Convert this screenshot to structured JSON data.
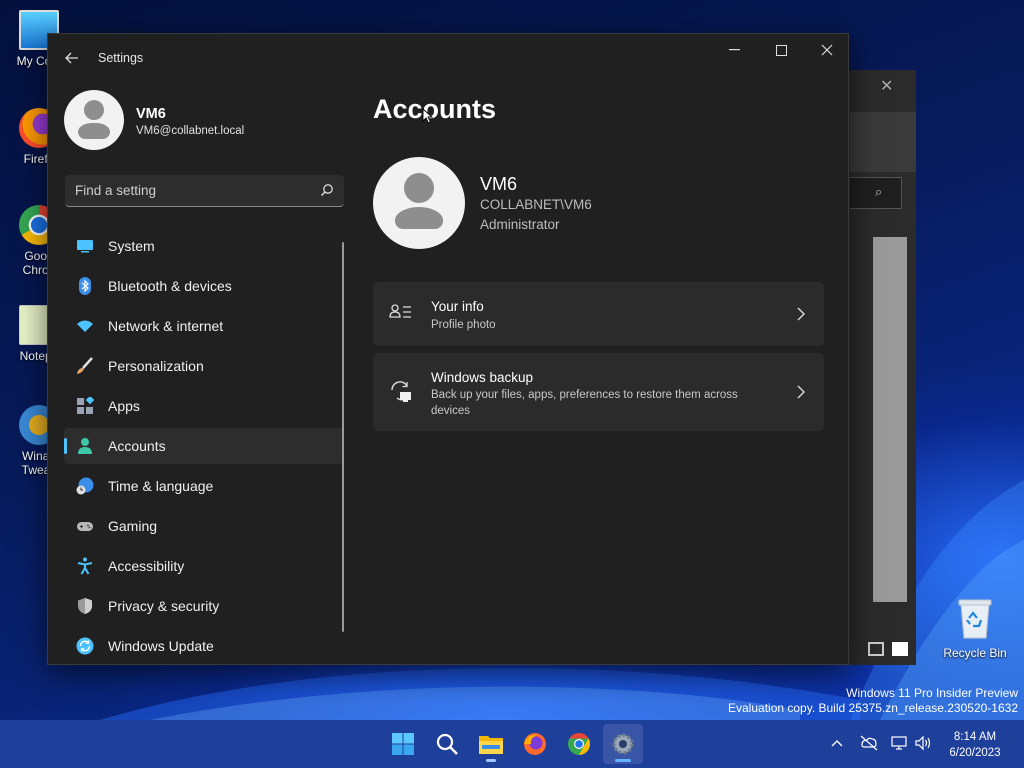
{
  "desktop": {
    "icons": [
      {
        "label": "My Com",
        "icon": "computer-icon"
      },
      {
        "label": "Firefo",
        "icon": "firefox-icon"
      },
      {
        "label": "Goog",
        "label2": "Chron",
        "icon": "chrome-icon"
      },
      {
        "label": "Notepa",
        "icon": "notepad-icon"
      },
      {
        "label": "Winae",
        "label2": "Tweak",
        "icon": "winaero-icon"
      }
    ],
    "recycle_bin": {
      "label": "Recycle Bin",
      "icon": "recycle-bin-icon"
    },
    "watermark": {
      "line1": "Windows 11 Pro Insider Preview",
      "line2": "Evaluation copy. Build 25375.zn_release.230520-1632"
    }
  },
  "window": {
    "title": "Settings",
    "back_icon": "back-arrow-icon",
    "controls": [
      "minimize-icon",
      "maximize-icon",
      "close-icon"
    ]
  },
  "profile": {
    "name": "VM6",
    "email": "VM6@collabnet.local"
  },
  "search": {
    "placeholder": "Find a setting",
    "icon": "search-icon"
  },
  "nav": {
    "items": [
      {
        "label": "System",
        "icon": "system-icon",
        "color": "#4cc2ff"
      },
      {
        "label": "Bluetooth & devices",
        "icon": "bluetooth-icon",
        "color": "#3b8eea"
      },
      {
        "label": "Network & internet",
        "icon": "wifi-icon",
        "color": "#4cc2ff"
      },
      {
        "label": "Personalization",
        "icon": "brush-icon",
        "color": "#e8a46a"
      },
      {
        "label": "Apps",
        "icon": "apps-icon",
        "color": "#9aa3b5"
      },
      {
        "label": "Accounts",
        "icon": "accounts-icon",
        "color": "#3ec6a8",
        "active": true
      },
      {
        "label": "Time & language",
        "icon": "clock-globe-icon",
        "color": "#3b8eea"
      },
      {
        "label": "Gaming",
        "icon": "gamepad-icon",
        "color": "#b8b8b8"
      },
      {
        "label": "Accessibility",
        "icon": "accessibility-icon",
        "color": "#4cc2ff"
      },
      {
        "label": "Privacy & security",
        "icon": "shield-icon",
        "color": "#9a9a9a"
      },
      {
        "label": "Windows Update",
        "icon": "update-icon",
        "color": "#4cc2ff"
      }
    ]
  },
  "main": {
    "title": "Accounts",
    "account": {
      "name": "VM6",
      "domain": "COLLABNET\\VM6",
      "role": "Administrator"
    },
    "cards": [
      {
        "title": "Your info",
        "subtitle": "Profile photo",
        "icon": "your-info-icon"
      },
      {
        "title": "Windows backup",
        "subtitle": "Back up your files, apps, preferences to restore them across devices",
        "icon": "backup-icon"
      }
    ]
  },
  "taskbar": {
    "apps": [
      "start-icon",
      "search-icon",
      "file-explorer-icon",
      "firefox-icon",
      "chrome-icon",
      "settings-icon"
    ],
    "tray": [
      "chevron-up-icon",
      "network-off-icon",
      "display-icon",
      "volume-icon"
    ],
    "time": "8:14 AM",
    "date": "6/20/2023"
  }
}
